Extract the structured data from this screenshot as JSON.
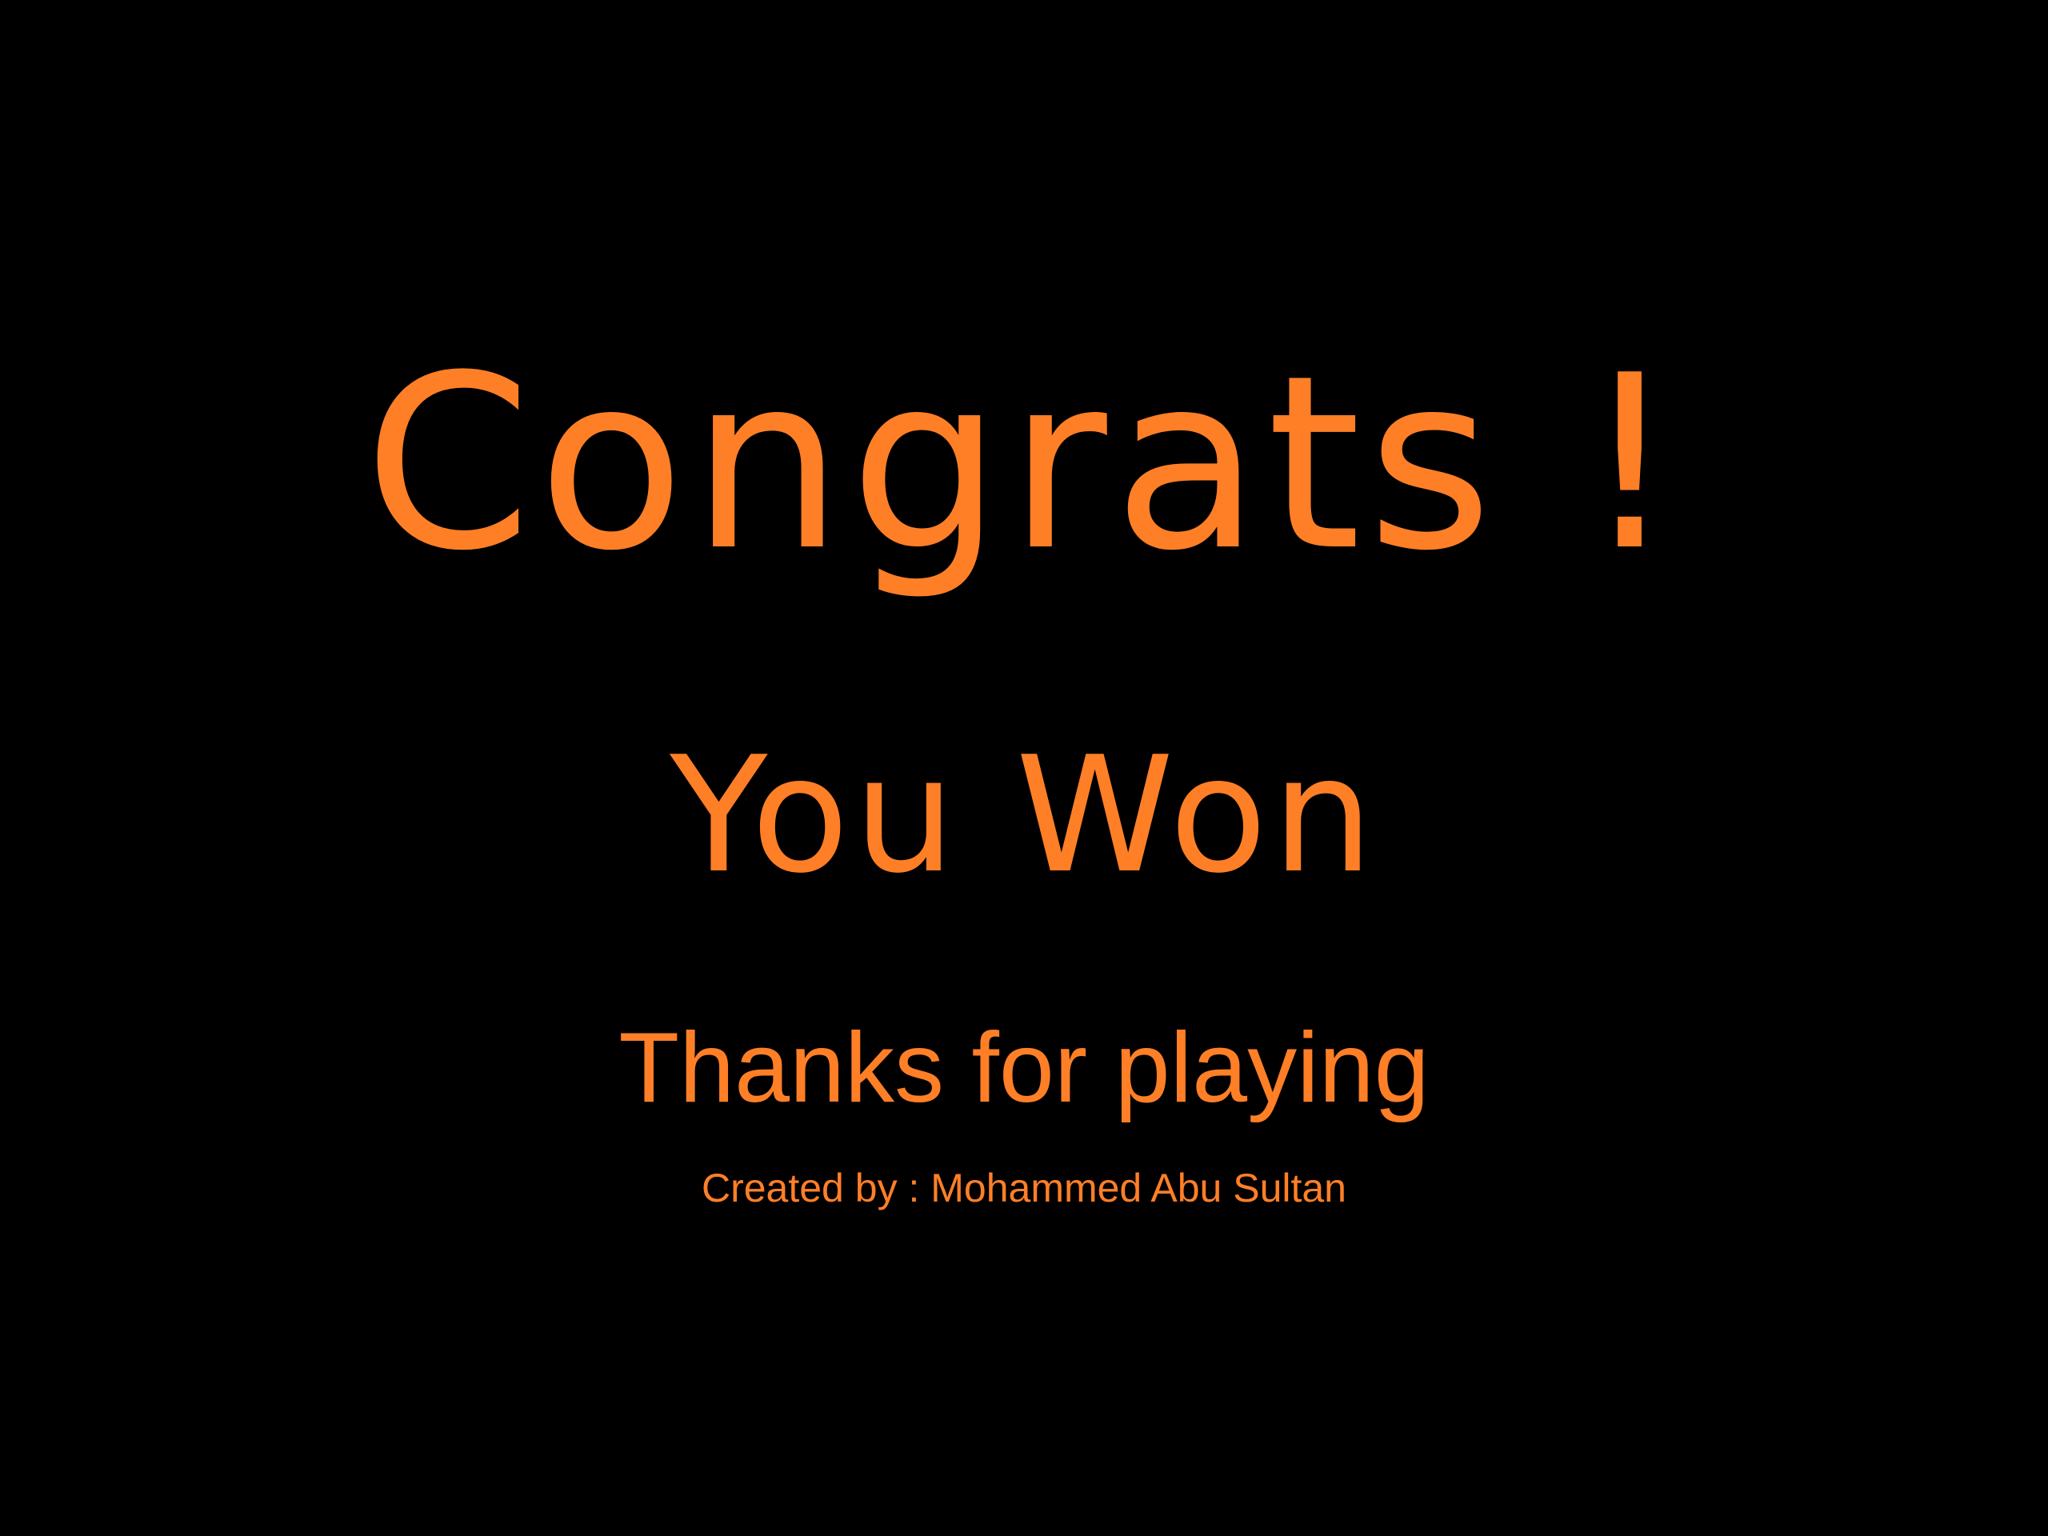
{
  "end_screen": {
    "headline": "Congrats !",
    "result": "You Won",
    "thanks": "Thanks for playing",
    "credits": "Created by : Mohammed Abu Sultan"
  },
  "colors": {
    "background": "#000000",
    "text": "#FF7F27"
  }
}
